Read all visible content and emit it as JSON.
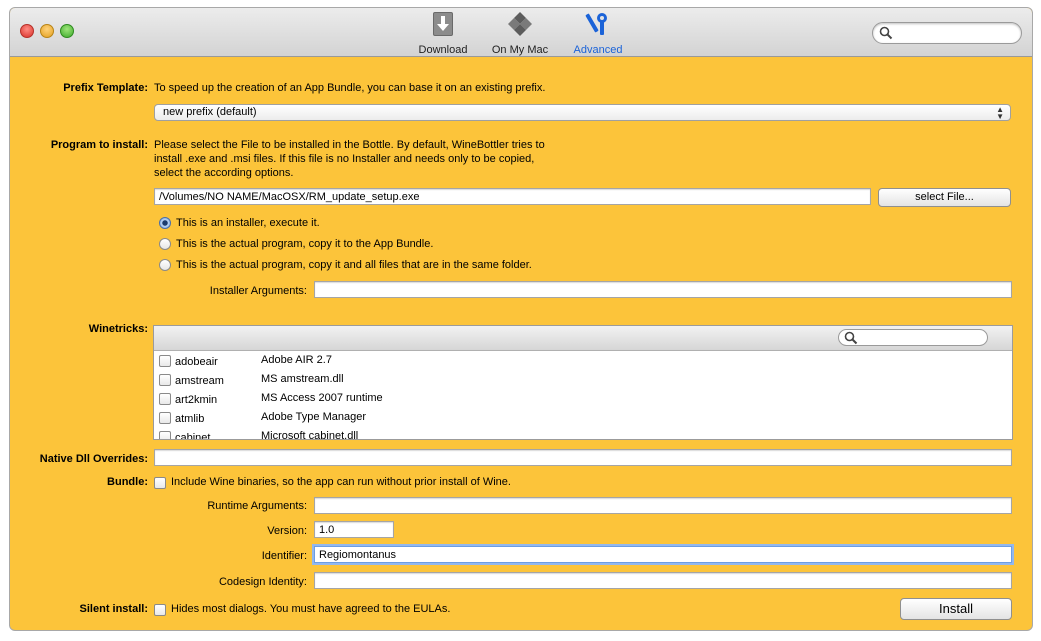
{
  "toolbar": {
    "items": [
      {
        "label": "Download",
        "icon": "download-icon"
      },
      {
        "label": "On My Mac",
        "icon": "on-my-mac-icon"
      },
      {
        "label": "Advanced",
        "icon": "advanced-tools-icon",
        "active": true
      }
    ],
    "search_placeholder": ""
  },
  "prefix": {
    "label": "Prefix Template:",
    "description": "To speed up the creation of an App Bundle, you can base it on an existing prefix.",
    "selected": "new prefix (default)"
  },
  "program": {
    "label": "Program to install:",
    "description_lines": [
      "Please select the File to be installed in the Bottle. By default, WineBottler tries to",
      "install .exe and .msi files. If this file is no Installer and needs only to be copied,",
      "select the according options."
    ],
    "path": "/Volumes/NO NAME/MacOSX/RM_update_setup.exe",
    "select_button": "select File...",
    "options": [
      {
        "label": "This is an installer, execute it.",
        "selected": true
      },
      {
        "label": "This is the actual program, copy it to the App Bundle.",
        "selected": false
      },
      {
        "label": "This is the actual program, copy it and all files that are in the same folder.",
        "selected": false
      }
    ],
    "installer_args_label": "Installer Arguments:",
    "installer_args_value": ""
  },
  "winetricks": {
    "label": "Winetricks:",
    "items": [
      {
        "name": "adobeair",
        "description": "Adobe AIR 2.7"
      },
      {
        "name": "amstream",
        "description": "MS amstream.dll"
      },
      {
        "name": "art2kmin",
        "description": "MS Access 2007 runtime"
      },
      {
        "name": "atmlib",
        "description": "Adobe Type Manager"
      },
      {
        "name": "cabinet",
        "description": "Microsoft cabinet.dll"
      }
    ]
  },
  "dll_overrides": {
    "label": "Native Dll Overrides:",
    "value": ""
  },
  "bundle": {
    "label": "Bundle:",
    "checkbox_label": "Include Wine binaries, so the app can run without prior install of Wine.",
    "runtime_args_label": "Runtime Arguments:",
    "runtime_args_value": "",
    "version_label": "Version:",
    "version_value": "1.0",
    "identifier_label": "Identifier:",
    "identifier_value": "Regiomontanus",
    "codesign_label": "Codesign Identity:",
    "codesign_value": ""
  },
  "silent": {
    "label": "Silent install:",
    "checkbox_label": "Hides most dialogs. You must have agreed to the EULAs."
  },
  "install_button": "Install",
  "colors": {
    "background": "#fcc43a",
    "accent": "#1b63d8"
  }
}
